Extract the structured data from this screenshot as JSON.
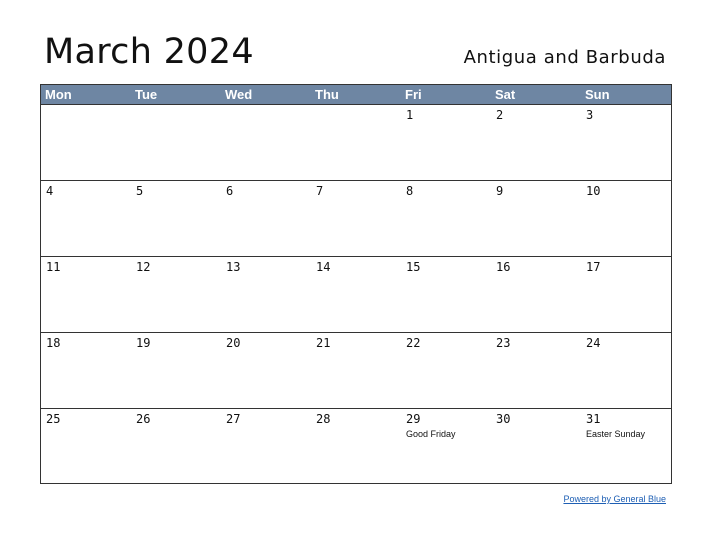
{
  "header": {
    "title": "March 2024",
    "country": "Antigua and Barbuda"
  },
  "colors": {
    "header_background": "#6e86a3",
    "header_text": "#ffffff",
    "grid_line": "#333333",
    "link": "#1e5fb4"
  },
  "calendar": {
    "weekdays": [
      "Mon",
      "Tue",
      "Wed",
      "Thu",
      "Fri",
      "Sat",
      "Sun"
    ],
    "weeks": [
      [
        {
          "day": "",
          "holiday": ""
        },
        {
          "day": "",
          "holiday": ""
        },
        {
          "day": "",
          "holiday": ""
        },
        {
          "day": "",
          "holiday": ""
        },
        {
          "day": "1",
          "holiday": ""
        },
        {
          "day": "2",
          "holiday": ""
        },
        {
          "day": "3",
          "holiday": ""
        }
      ],
      [
        {
          "day": "4",
          "holiday": ""
        },
        {
          "day": "5",
          "holiday": ""
        },
        {
          "day": "6",
          "holiday": ""
        },
        {
          "day": "7",
          "holiday": ""
        },
        {
          "day": "8",
          "holiday": ""
        },
        {
          "day": "9",
          "holiday": ""
        },
        {
          "day": "10",
          "holiday": ""
        }
      ],
      [
        {
          "day": "11",
          "holiday": ""
        },
        {
          "day": "12",
          "holiday": ""
        },
        {
          "day": "13",
          "holiday": ""
        },
        {
          "day": "14",
          "holiday": ""
        },
        {
          "day": "15",
          "holiday": ""
        },
        {
          "day": "16",
          "holiday": ""
        },
        {
          "day": "17",
          "holiday": ""
        }
      ],
      [
        {
          "day": "18",
          "holiday": ""
        },
        {
          "day": "19",
          "holiday": ""
        },
        {
          "day": "20",
          "holiday": ""
        },
        {
          "day": "21",
          "holiday": ""
        },
        {
          "day": "22",
          "holiday": ""
        },
        {
          "day": "23",
          "holiday": ""
        },
        {
          "day": "24",
          "holiday": ""
        }
      ],
      [
        {
          "day": "25",
          "holiday": ""
        },
        {
          "day": "26",
          "holiday": ""
        },
        {
          "day": "27",
          "holiday": ""
        },
        {
          "day": "28",
          "holiday": ""
        },
        {
          "day": "29",
          "holiday": "Good Friday"
        },
        {
          "day": "30",
          "holiday": ""
        },
        {
          "day": "31",
          "holiday": "Easter Sunday"
        }
      ]
    ]
  },
  "footer": {
    "powered_by": "Powered by General Blue"
  }
}
